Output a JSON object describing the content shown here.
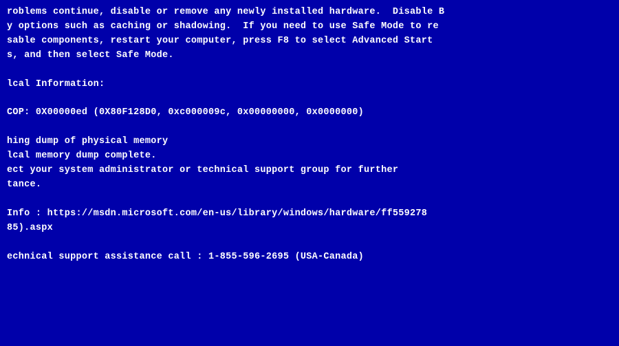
{
  "bsod": {
    "background_color": "#0000AA",
    "text_color": "#FFFFFF",
    "content": "roblems continue, disable or remove any newly installed hardware.  Disable B\ny options such as caching or shadowing.  If you need to use Safe Mode to re\nsable components, restart your computer, press F8 to select Advanced Start\ns, and then select Safe Mode.\n\nlcal Information:\n\nCOP: 0X00000ed (0X80F128D0, 0xc000009c, 0x00000000, 0x0000000)\n\nhing dump of physical memory\nlcal memory dump complete.\nect your system administrator or technical support group for further\ntance.\n\nInfo : https://msdn.microsoft.com/en-us/library/windows/hardware/ff559278\n85).aspx\n\nechnical support assistance call : 1-855-596-2695 (USA-Canada)"
  }
}
